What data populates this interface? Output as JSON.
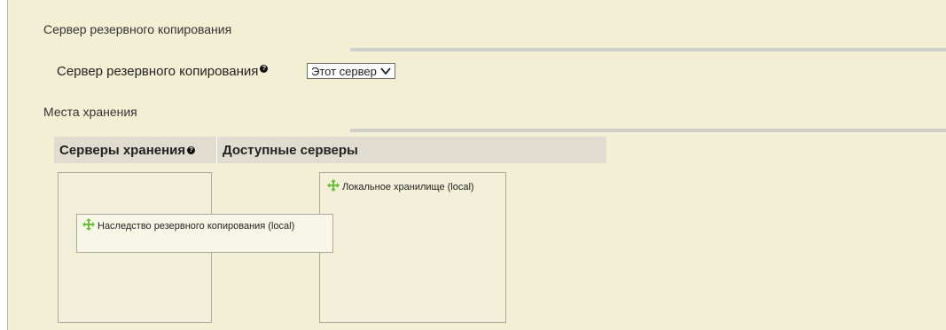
{
  "backup_server_section": {
    "title": "Сервер резервного копирования",
    "field_label": "Сервер резервного копирования",
    "help_glyph": "?",
    "select_value": "Этот сервер"
  },
  "storage_section": {
    "title": "Места хранения",
    "columns": {
      "storage_servers": "Серверы хранения",
      "available_servers": "Доступные серверы"
    },
    "help_glyph": "?",
    "storage_items": [
      {
        "label": "Наследство резервного копирования (local)"
      }
    ],
    "available_items": [
      {
        "label": "Локальное хранилище (local)"
      }
    ]
  },
  "colors": {
    "panel_bg": "#f3efd5",
    "header_bg": "#e0ddd0",
    "move_icon": "#6cbf3a"
  },
  "icons": {
    "help": "help-icon",
    "move": "move-icon",
    "dropdown": "chevron-down-icon"
  }
}
